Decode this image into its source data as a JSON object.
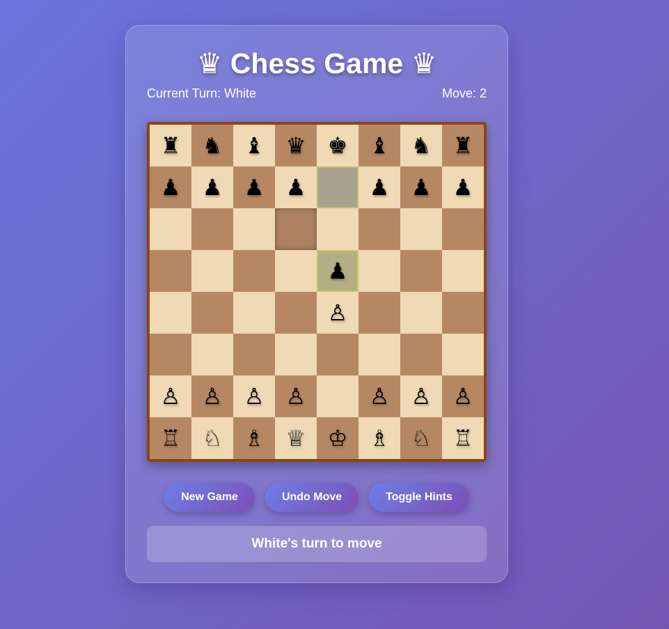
{
  "title": {
    "text": "Chess Game",
    "icon_left": "♛",
    "icon_right": "♛"
  },
  "status": {
    "turn_text": "Current Turn: White",
    "move_text": "Move: 2"
  },
  "board": {
    "orientation": "white-bottom",
    "rows": [
      [
        "♜",
        "♞",
        "♝",
        "♛",
        "♚",
        "♝",
        "♞",
        "♜"
      ],
      [
        "♟",
        "♟",
        "♟",
        "♟",
        "",
        "♟",
        "♟",
        "♟"
      ],
      [
        "",
        "",
        "",
        "",
        "",
        "",
        "",
        ""
      ],
      [
        "",
        "",
        "",
        "",
        "♟",
        "",
        "",
        ""
      ],
      [
        "",
        "",
        "",
        "",
        "♙",
        "",
        "",
        ""
      ],
      [
        "",
        "",
        "",
        "",
        "",
        "",
        "",
        ""
      ],
      [
        "♙",
        "♙",
        "♙",
        "♙",
        "",
        "♙",
        "♙",
        "♙"
      ],
      [
        "♖",
        "♘",
        "♗",
        "♕",
        "♔",
        "♗",
        "♘",
        "♖"
      ]
    ],
    "last_move": {
      "from": "e7",
      "to": "e5"
    },
    "hovered": "d6",
    "colors": {
      "light": "#f0d9b5",
      "dark": "#b58863",
      "border": "#8b4513",
      "highlight": "#b3ae86"
    }
  },
  "buttons": {
    "new_game": "New Game",
    "undo_move": "Undo Move",
    "toggle_hints": "Toggle Hints"
  },
  "message": "White's turn to move"
}
